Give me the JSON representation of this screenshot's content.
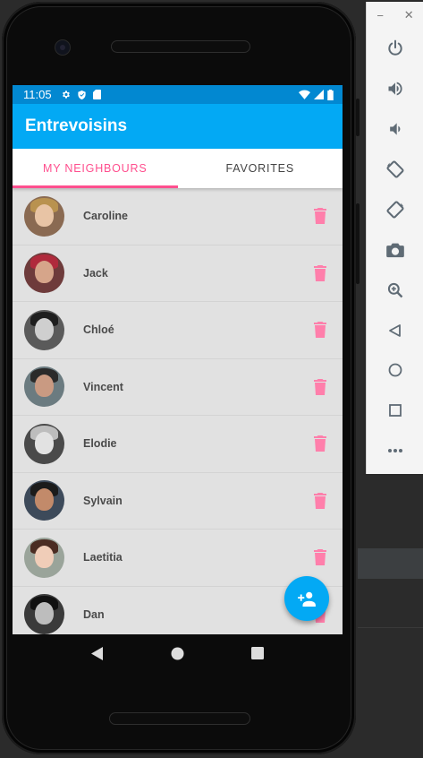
{
  "status_bar": {
    "time": "11:05"
  },
  "app": {
    "title": "Entrevoisins"
  },
  "tabs": [
    {
      "label": "MY NEIGHBOURS",
      "active": true
    },
    {
      "label": "FAVORITES",
      "active": false
    }
  ],
  "neighbours": [
    {
      "name": "Caroline"
    },
    {
      "name": "Jack"
    },
    {
      "name": "Chloé"
    },
    {
      "name": "Vincent"
    },
    {
      "name": "Elodie"
    },
    {
      "name": "Sylvain"
    },
    {
      "name": "Laetitia"
    },
    {
      "name": "Dan"
    }
  ],
  "emulator": {
    "minimize_label": "−",
    "close_label": "✕",
    "buttons": [
      "power-icon",
      "volume-up-icon",
      "volume-down-icon",
      "rotate-left-icon",
      "rotate-right-icon",
      "camera-icon",
      "zoom-icon",
      "back-icon",
      "home-icon",
      "overview-icon",
      "more-icon"
    ]
  },
  "colors": {
    "primary": "#03a9f4",
    "primary_dark": "#0288d1",
    "accent": "#ff4f8e"
  }
}
